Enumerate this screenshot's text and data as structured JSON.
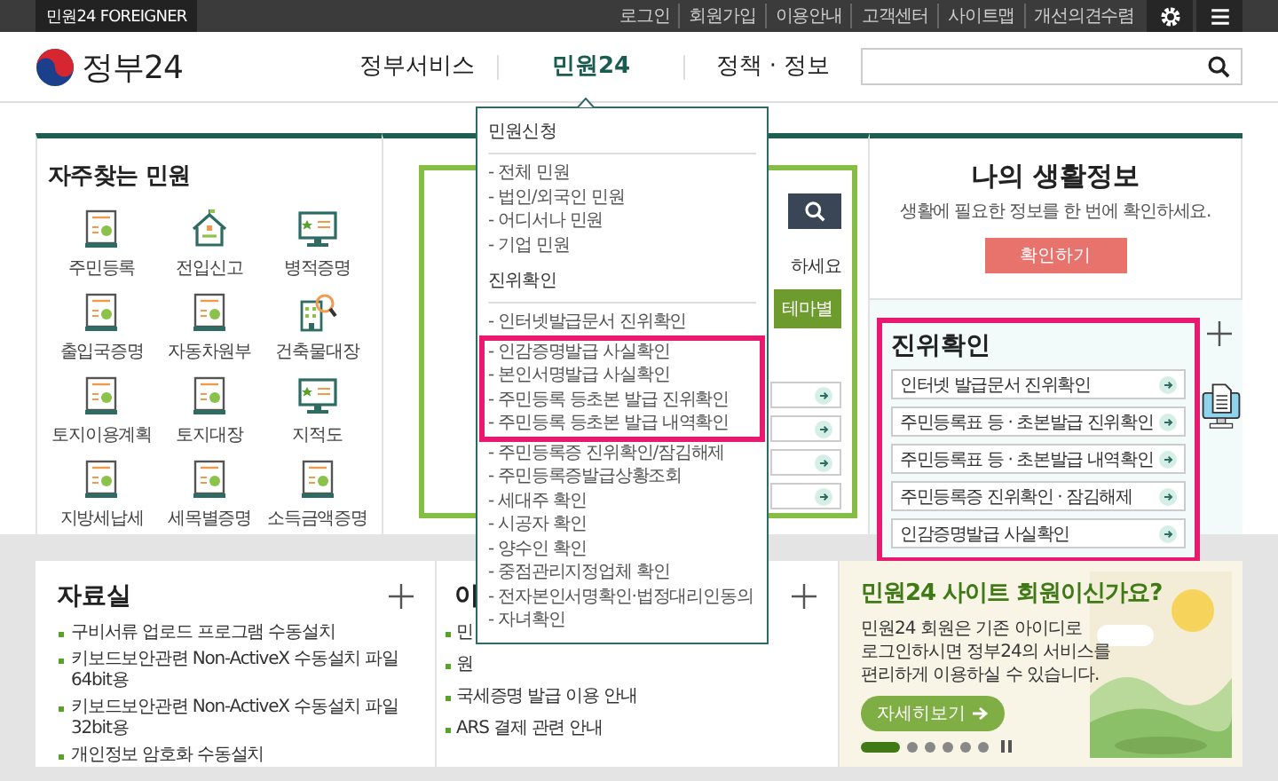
{
  "top_bar": {
    "foreigner_link": "민원24 FOREIGNER",
    "links": [
      "로그인",
      "회원가입",
      "이용안내",
      "고객센터",
      "사이트맵",
      "개선의견수렴"
    ]
  },
  "header": {
    "logo": "정부24",
    "nav": [
      {
        "label": "정부서비스",
        "selected": false
      },
      {
        "label": "민원24",
        "selected": true
      },
      {
        "label": "정책 · 정보",
        "selected": false
      }
    ]
  },
  "frequent": {
    "title": "자주찾는 민원",
    "items": [
      "주민등록",
      "전입신고",
      "병적증명",
      "출입국증명",
      "자동차원부",
      "건축물대장",
      "토지이용계획",
      "토지대장",
      "지적도",
      "지방세납세",
      "세목별증명",
      "소득금액증명"
    ]
  },
  "middle_panel": {
    "text_fragment": "하세요",
    "button": "테마별"
  },
  "life_info": {
    "title": "나의 생활정보",
    "description": "생활에 필요한 정보를 한 번에 확인하세요.",
    "button": "확인하기"
  },
  "verification": {
    "title": "진위확인",
    "highlighted": true,
    "items": [
      "인터넷 발급문서 진위확인",
      "주민등록표 등 · 초본발급 진위확인",
      "주민등록표 등 · 초본발급 내역확인",
      "주민등록증 진위확인 · 잠김해제",
      "인감증명발급 사실확인"
    ]
  },
  "downloads": {
    "title": "자료실",
    "items": [
      "구비서류 업로드 프로그램 수동설치",
      "키보드보안관련 Non-ActiveX 수동설치 파일 64bit용",
      "키보드보안관련 Non-ActiveX 수동설치 파일 32bit용",
      "개인정보 암호화 수동설치"
    ]
  },
  "notices": {
    "title": "이",
    "items": [
      "민",
      "원",
      "국세증명 발급 이용 안내",
      "ARS 결제 관련 안내"
    ]
  },
  "banner": {
    "title": "민원24 사이트 회원이신가요?",
    "text": "민원24 회원은 기존 아이디로\n로그인하시면 정부24의 서비스를\n편리하게 이용하실 수 있습니다.",
    "button": "자세히보기",
    "slides": [
      {
        "selected": true
      },
      {
        "selected": false
      },
      {
        "selected": false
      },
      {
        "selected": false
      },
      {
        "selected": false
      },
      {
        "selected": false
      }
    ]
  },
  "menu": {
    "sections": [
      {
        "title": "민원신청",
        "items": [
          {
            "label": "- 전체 민원",
            "highlighted": false
          },
          {
            "label": "- 법인/외국인 민원",
            "highlighted": false
          },
          {
            "label": "- 어디서나 민원",
            "highlighted": false
          },
          {
            "label": "- 기업 민원",
            "highlighted": false
          }
        ]
      },
      {
        "title": "진위확인",
        "items": [
          {
            "label": "- 인터넷발급문서 진위확인",
            "highlighted": false
          },
          {
            "label": "- 인감증명발급 사실확인",
            "highlighted": true
          },
          {
            "label": "- 본인서명발급 사실확인",
            "highlighted": true
          },
          {
            "label": "- 주민등록 등초본 발급 진위확인",
            "highlighted": true
          },
          {
            "label": "- 주민등록 등초본 발급 내역확인",
            "highlighted": true
          },
          {
            "label": "- 주민등록증 진위확인/잠김해제",
            "highlighted": false
          },
          {
            "label": "- 주민등록증발급상황조회",
            "highlighted": false
          },
          {
            "label": "- 세대주 확인",
            "highlighted": false
          },
          {
            "label": "- 시공자 확인",
            "highlighted": false
          },
          {
            "label": "- 양수인 확인",
            "highlighted": false
          },
          {
            "label": "- 중점관리지정업체 확인",
            "highlighted": false
          },
          {
            "label": "- 전자본인서명확인·법정대리인동의",
            "highlighted": false
          },
          {
            "label": "- 자녀확인",
            "highlighted": false
          }
        ]
      }
    ]
  }
}
